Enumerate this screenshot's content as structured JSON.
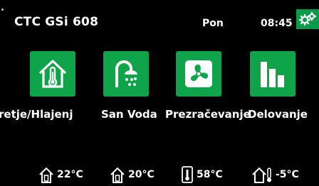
{
  "header": {
    "title": "CTC GSi 608",
    "day": "Pon",
    "time": "08:45",
    "settings_icon": "gears-icon"
  },
  "menu": [
    {
      "label": "Ogretje/Hlajenje",
      "visible_text": "retje/Hlajenj",
      "icon": "house-thermometer-icon"
    },
    {
      "label": "San Voda",
      "icon": "shower-icon"
    },
    {
      "label": "Prezračevanje",
      "icon": "fan-icon"
    },
    {
      "label": "Delovanje",
      "icon": "bar-chart-icon"
    }
  ],
  "status": [
    {
      "value": "22°C",
      "icon": "house-outline-icon"
    },
    {
      "value": "20°C",
      "icon": "house-outline-icon"
    },
    {
      "value": "58°C",
      "icon": "thermometer-icon"
    },
    {
      "value": "-5°C",
      "icon": "house-outdoor-thermometer-icon"
    }
  ],
  "colors": {
    "accent": "#0fa44a",
    "background": "#000000",
    "text": "#ffffff"
  }
}
